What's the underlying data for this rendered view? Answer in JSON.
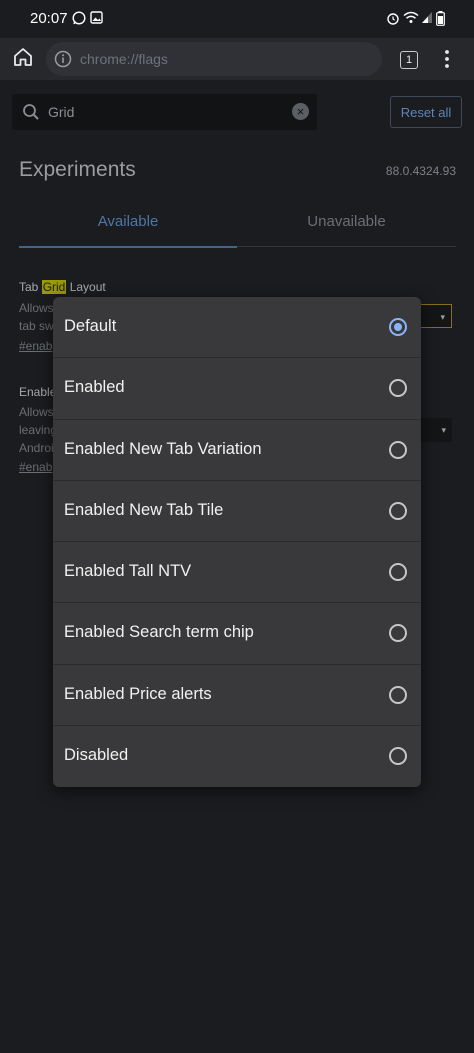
{
  "status_bar": {
    "time": "20:07"
  },
  "toolbar": {
    "url": "chrome://flags",
    "tab_count": "1"
  },
  "search": {
    "value": "Grid"
  },
  "reset_button": "Reset all",
  "page": {
    "title": "Experiments",
    "version": "88.0.4324.93",
    "tabs": [
      "Available",
      "Unavailable"
    ]
  },
  "flags": [
    {
      "title_prefix": "Tab ",
      "title_highlight": "Grid",
      "title_suffix": " Layout",
      "desc_lines": [
        "Allows",
        "tab sw"
      ],
      "link": "#enab"
    },
    {
      "title_prefix": "Enable",
      "desc_lines": [
        "Allows",
        "leaving",
        "Androi"
      ],
      "link": "#enab"
    }
  ],
  "dialog": {
    "selected_index": 0,
    "options": [
      "Default",
      "Enabled",
      "Enabled New Tab Variation",
      "Enabled New Tab Tile",
      "Enabled Tall NTV",
      "Enabled Search term chip",
      "Enabled Price alerts",
      "Disabled"
    ]
  },
  "colors": {
    "background": "#1b1c1f",
    "dialog": "#39393b",
    "accent": "#8ab4f8",
    "highlight": "#9a9b00"
  }
}
